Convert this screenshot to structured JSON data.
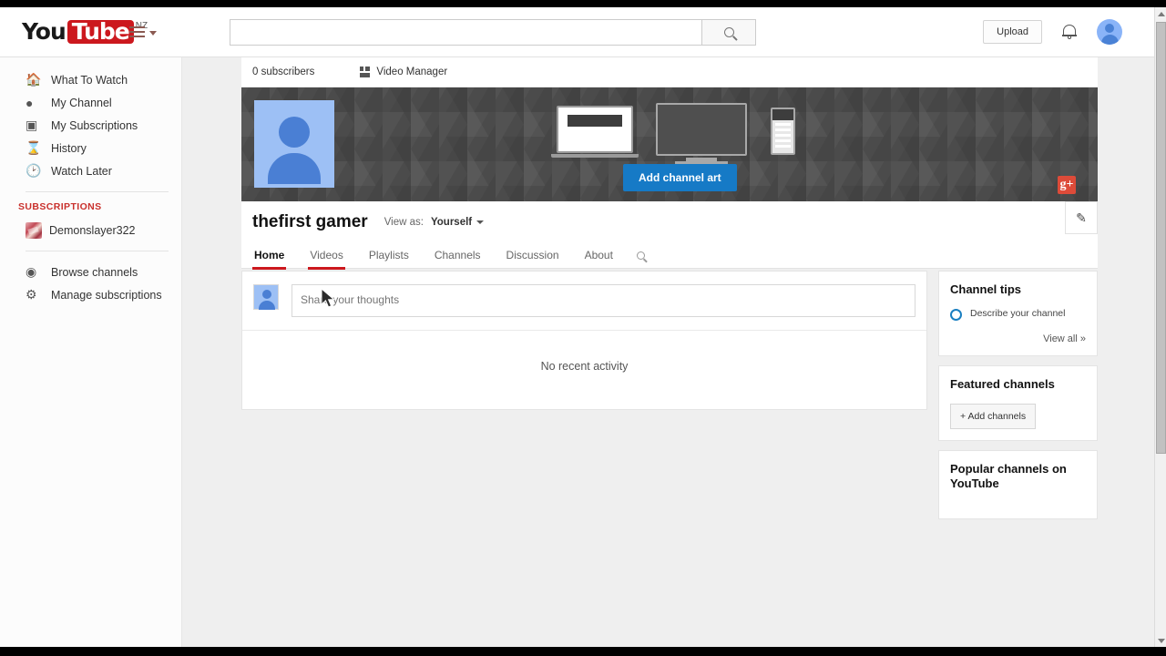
{
  "masthead": {
    "logo_you": "You",
    "logo_tube": "Tube",
    "logo_region": "NZ",
    "menu_icon": "hamburger-menu-icon",
    "search": {
      "value": "",
      "placeholder": ""
    },
    "search_icon": "search-icon",
    "upload_label": "Upload",
    "notifications_icon": "bell-icon",
    "account_avatar": "user-avatar-icon"
  },
  "sidebar": {
    "items": [
      {
        "label": "What To Watch",
        "icon": "home-icon"
      },
      {
        "label": "My Channel",
        "icon": "account-circle-icon"
      },
      {
        "label": "My Subscriptions",
        "icon": "subscriptions-icon"
      },
      {
        "label": "History",
        "icon": "hourglass-icon"
      },
      {
        "label": "Watch Later",
        "icon": "clock-icon"
      }
    ],
    "section_header": "SUBSCRIPTIONS",
    "subscriptions": [
      {
        "label": "Demonslayer322",
        "icon": "channel-thumbnail"
      }
    ],
    "footer_items": [
      {
        "label": "Browse channels",
        "icon": "compass-icon"
      },
      {
        "label": "Manage subscriptions",
        "icon": "gear-icon"
      }
    ]
  },
  "channel": {
    "subscribers": "0 subscribers",
    "video_manager": "Video Manager",
    "video_manager_icon": "grid-icon",
    "name": "thefirst gamer",
    "view_as_label": "View as:",
    "view_as_value": "Yourself",
    "add_channel_art": "Add channel art",
    "gplus_icon": "google-plus-icon",
    "gplus_glyph": "g+",
    "edit_icon": "pencil-icon",
    "edit_glyph": "✎",
    "banner_avatar": "channel-avatar",
    "devices": [
      "laptop-illustration",
      "tv-illustration",
      "phone-illustration"
    ],
    "tabs": [
      {
        "label": "Home",
        "state": "active"
      },
      {
        "label": "Videos",
        "state": "hovered"
      },
      {
        "label": "Playlists",
        "state": "default"
      },
      {
        "label": "Channels",
        "state": "default"
      },
      {
        "label": "Discussion",
        "state": "default"
      },
      {
        "label": "About",
        "state": "default"
      }
    ],
    "tab_search_icon": "search-icon"
  },
  "activity": {
    "share_placeholder": "Share your thoughts",
    "share_value": "",
    "empty_message": "No recent activity",
    "avatar": "user-avatar-icon"
  },
  "rail": {
    "tips": {
      "title": "Channel tips",
      "items": [
        {
          "text": "Describe your channel",
          "icon": "circle-icon"
        }
      ],
      "view_all": "View all »"
    },
    "featured": {
      "title": "Featured channels",
      "add_button": "+ Add channels"
    },
    "popular": {
      "title": "Popular channels on YouTube"
    }
  },
  "colors": {
    "brand_red": "#cc181e",
    "accent_blue": "#167ac6",
    "tip_blue": "#1a7fc1",
    "page_bg": "#efefef",
    "banner_gray": "#4b4b4b"
  },
  "scrollbar": {
    "up_icon": "chevron-up-icon",
    "down_icon": "chevron-down-icon"
  }
}
